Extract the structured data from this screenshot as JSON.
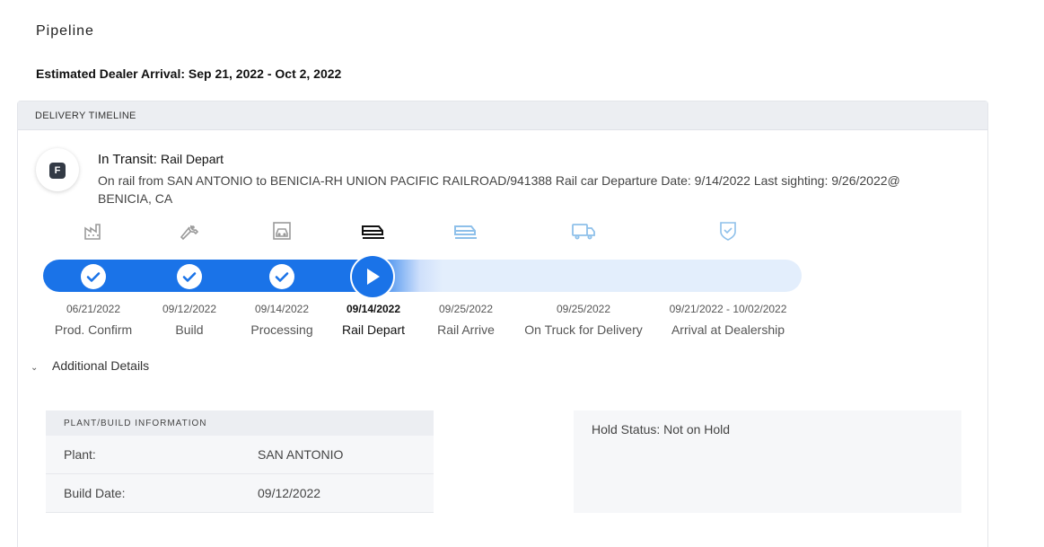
{
  "page": {
    "title": "Pipeline",
    "estimated_arrival": "Estimated Dealer Arrival: Sep 21, 2022 - Oct 2, 2022"
  },
  "timeline_card": {
    "header": "DELIVERY TIMELINE",
    "avatar_letter": "F",
    "status_prefix": "In Transit: ",
    "status_sub": "Rail Depart",
    "status_desc": "On rail from SAN ANTONIO to BENICIA-RH UNION PACIFIC RAILROAD/941388 Rail car Departure Date: 9/14/2022 Last sighting: 9/26/2022@ BENICIA, CA"
  },
  "steps": [
    {
      "date": "06/21/2022",
      "label": "Prod. Confirm",
      "state": "done",
      "icon": "factory-icon"
    },
    {
      "date": "09/12/2022",
      "label": "Build",
      "state": "done",
      "icon": "wrench-icon"
    },
    {
      "date": "09/14/2022",
      "label": "Processing",
      "state": "done",
      "icon": "car-icon"
    },
    {
      "date": "09/14/2022",
      "label": "Rail Depart",
      "state": "current",
      "icon": "train-icon"
    },
    {
      "date": "09/25/2022",
      "label": "Rail Arrive",
      "state": "pending",
      "icon": "train-icon"
    },
    {
      "date": "09/25/2022",
      "label": "On Truck for Delivery",
      "state": "pending",
      "icon": "truck-icon"
    },
    {
      "date": "09/21/2022 - 10/02/2022",
      "label": "Arrival at Dealership",
      "state": "pending",
      "icon": "shield-check-icon"
    }
  ],
  "additional_details": {
    "toggle_label": "Additional Details",
    "plant_header": "PLANT/BUILD INFORMATION",
    "plant_rows": [
      {
        "key": "Plant:",
        "value": "SAN ANTONIO"
      },
      {
        "key": "Build Date:",
        "value": "09/12/2022"
      }
    ],
    "hold_status": "Hold Status: Not on Hold"
  },
  "colors": {
    "accent": "#1a73e8",
    "done_icon": "#9a9a9a",
    "current_icon": "#111111",
    "pending_icon": "#8ec0ea"
  }
}
